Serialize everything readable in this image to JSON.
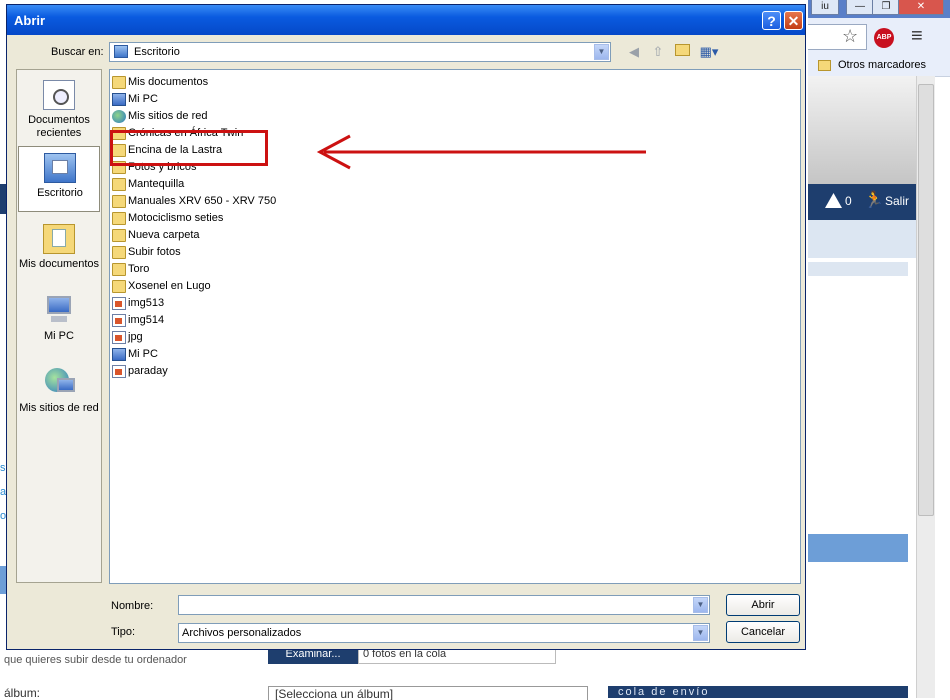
{
  "dialog": {
    "title": "Abrir",
    "help_glyph": "?",
    "close_glyph": "✕",
    "look_in_label": "Buscar en:",
    "look_in_value": "Escritorio",
    "name_label": "Nombre:",
    "name_value": "",
    "type_label": "Tipo:",
    "type_value": "Archivos personalizados",
    "open_button": "Abrir",
    "cancel_button": "Cancelar",
    "places": [
      {
        "label": "Documentos recientes",
        "icon": "recent-documents-icon"
      },
      {
        "label": "Escritorio",
        "icon": "desktop-icon",
        "selected": true
      },
      {
        "label": "Mis documentos",
        "icon": "my-documents-icon"
      },
      {
        "label": "Mi PC",
        "icon": "my-computer-icon"
      },
      {
        "label": "Mis sitios de red",
        "icon": "network-places-icon"
      }
    ],
    "files": [
      {
        "name": "Mis documentos",
        "icon": "documents-folder-icon"
      },
      {
        "name": "Mi PC",
        "icon": "computer-icon"
      },
      {
        "name": "Mis sitios de red",
        "icon": "network-icon"
      },
      {
        "name": "Crónicas en África Twin",
        "icon": "folder-icon"
      },
      {
        "name": "Encina de la Lastra",
        "icon": "folder-icon"
      },
      {
        "name": "Fotos y bricos",
        "icon": "folder-icon"
      },
      {
        "name": "Mantequilla",
        "icon": "folder-icon"
      },
      {
        "name": "Manuales XRV 650 - XRV 750",
        "icon": "folder-icon"
      },
      {
        "name": "Motociclismo seties",
        "icon": "folder-icon"
      },
      {
        "name": "Nueva carpeta",
        "icon": "folder-icon"
      },
      {
        "name": "Subir fotos",
        "icon": "folder-icon"
      },
      {
        "name": "Toro",
        "icon": "folder-icon"
      },
      {
        "name": "Xosenel en Lugo",
        "icon": "folder-icon"
      },
      {
        "name": "img513",
        "icon": "image-file-icon"
      },
      {
        "name": "img514",
        "icon": "image-file-icon"
      },
      {
        "name": "jpg",
        "icon": "image-file-icon"
      },
      {
        "name": "Mi PC",
        "icon": "computer-shortcut-icon"
      },
      {
        "name": "paraday",
        "icon": "image-file-icon"
      }
    ]
  },
  "browser": {
    "bookmarks_folder": "Otros marcadores",
    "abp_label": "ABP",
    "alerts_count": "0",
    "logout_label": "Salir",
    "upload_hint": "que quieres subir desde tu ordenador",
    "browse_button": "Examinar...",
    "queue_text": "0 fotos en la cola",
    "album_label": "álbum:",
    "album_select": "[Selecciona un álbum]",
    "queue_header": "cola de envío",
    "min_glyph": "—",
    "max_glyph": "❐",
    "close_glyph": "✕",
    "menu_glyph": "≡",
    "star_glyph": "☆"
  },
  "colors": {
    "title_bar": "#0548c8",
    "annotation": "#cc1111",
    "nav_bar": "#1e3e6e"
  }
}
